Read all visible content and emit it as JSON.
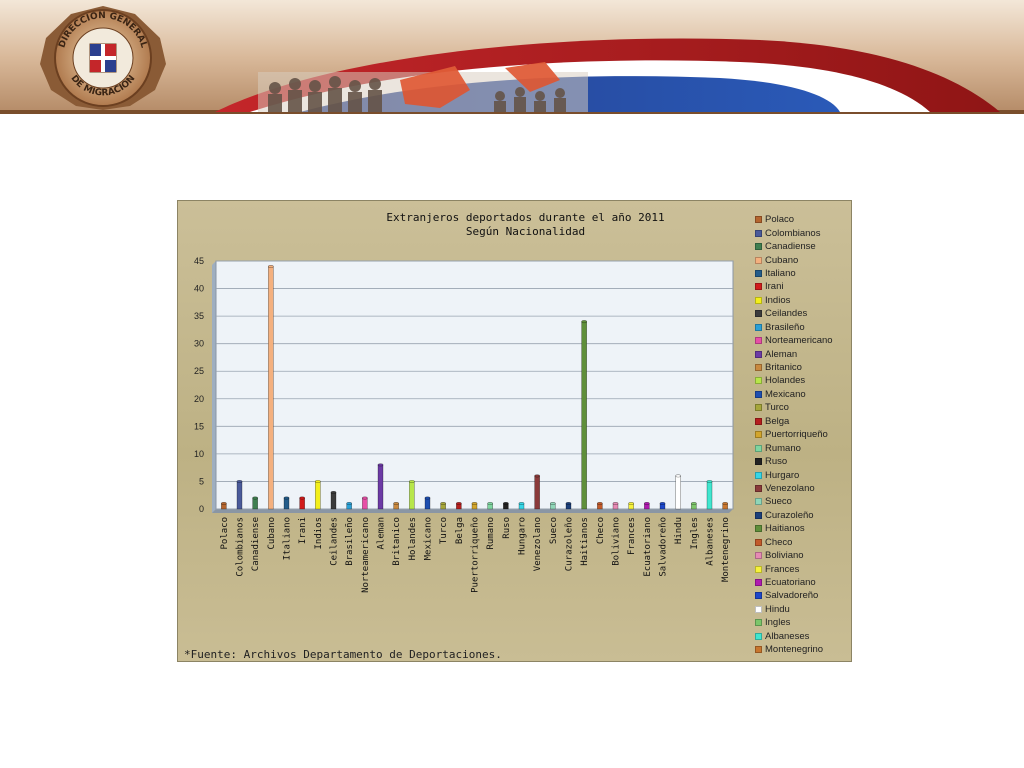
{
  "header": {
    "logo_text_top": "DIRECCION GENERAL",
    "logo_text_bottom": "DE MIGRACION"
  },
  "chart_data": {
    "type": "bar",
    "title": "Extranjeros deportados durante el año 2011",
    "subtitle": "Según Nacionalidad",
    "xlabel": "",
    "ylabel": "",
    "ylim": [
      0,
      45
    ],
    "yticks": [
      0,
      5,
      10,
      15,
      20,
      25,
      30,
      35,
      40,
      45
    ],
    "grid": true,
    "legend_position": "right",
    "categories": [
      "Polaco",
      "Colombianos",
      "Canadiense",
      "Cubano",
      "Italiano",
      "Irani",
      "Indios",
      "Ceilandes",
      "Brasileño",
      "Norteamericano",
      "Aleman",
      "Britanico",
      "Holandes",
      "Mexicano",
      "Turco",
      "Belga",
      "Puertorriqueño",
      "Rumano",
      "Ruso",
      "Hungaro",
      "Venezolano",
      "Sueco",
      "Curazoleño",
      "Haitianos",
      "Checo",
      "Boliviano",
      "Frances",
      "Ecuatoriano",
      "Salvadoreño",
      "Hindu",
      "Ingles",
      "Albaneses",
      "Montenegrino"
    ],
    "legend_labels": [
      "Polaco",
      "Colombianos",
      "Canadiense",
      "Cubano",
      "Italiano",
      "Irani",
      "Indios",
      "Ceilandes",
      "Brasileño",
      "Norteamericano",
      "Aleman",
      "Britanico",
      "Holandes",
      "Mexicano",
      "Turco",
      "Belga",
      "Puertorriqueño",
      "Rumano",
      "Ruso",
      "Hurgaro",
      "Venezolano",
      "Sueco",
      "Curazoleño",
      "Haitianos",
      "Checo",
      "Boliviano",
      "Frances",
      "Ecuatoriano",
      "Salvadoreño",
      "Hindu",
      "Ingles",
      "Albaneses",
      "Montenegrino"
    ],
    "values": [
      1,
      5,
      2,
      44,
      2,
      2,
      5,
      3,
      1,
      2,
      8,
      1,
      5,
      2,
      1,
      1,
      1,
      1,
      1,
      1,
      6,
      1,
      1,
      34,
      1,
      1,
      1,
      1,
      1,
      6,
      1,
      5,
      1
    ],
    "colors": [
      "#b5652e",
      "#4a5a9a",
      "#3f7f50",
      "#f4b07e",
      "#245c8a",
      "#d21b1b",
      "#f3ef1a",
      "#3b3b3b",
      "#2aa0d6",
      "#e64fa6",
      "#6c3aa5",
      "#c9893f",
      "#b7e64a",
      "#1e4fb0",
      "#a6a63a",
      "#b51e1e",
      "#d2a52c",
      "#7ed6a0",
      "#222222",
      "#36d6e6",
      "#8a3a3a",
      "#8fd6b8",
      "#1b3f7a",
      "#5f8f3a",
      "#c25a2a",
      "#e68ab4",
      "#f6f23a",
      "#b01ab0",
      "#1d47c9",
      "#ffffff",
      "#7cc66a",
      "#40e6cf",
      "#c8762e"
    ]
  },
  "source_note": "*Fuente: Archivos Departamento de Deportaciones."
}
